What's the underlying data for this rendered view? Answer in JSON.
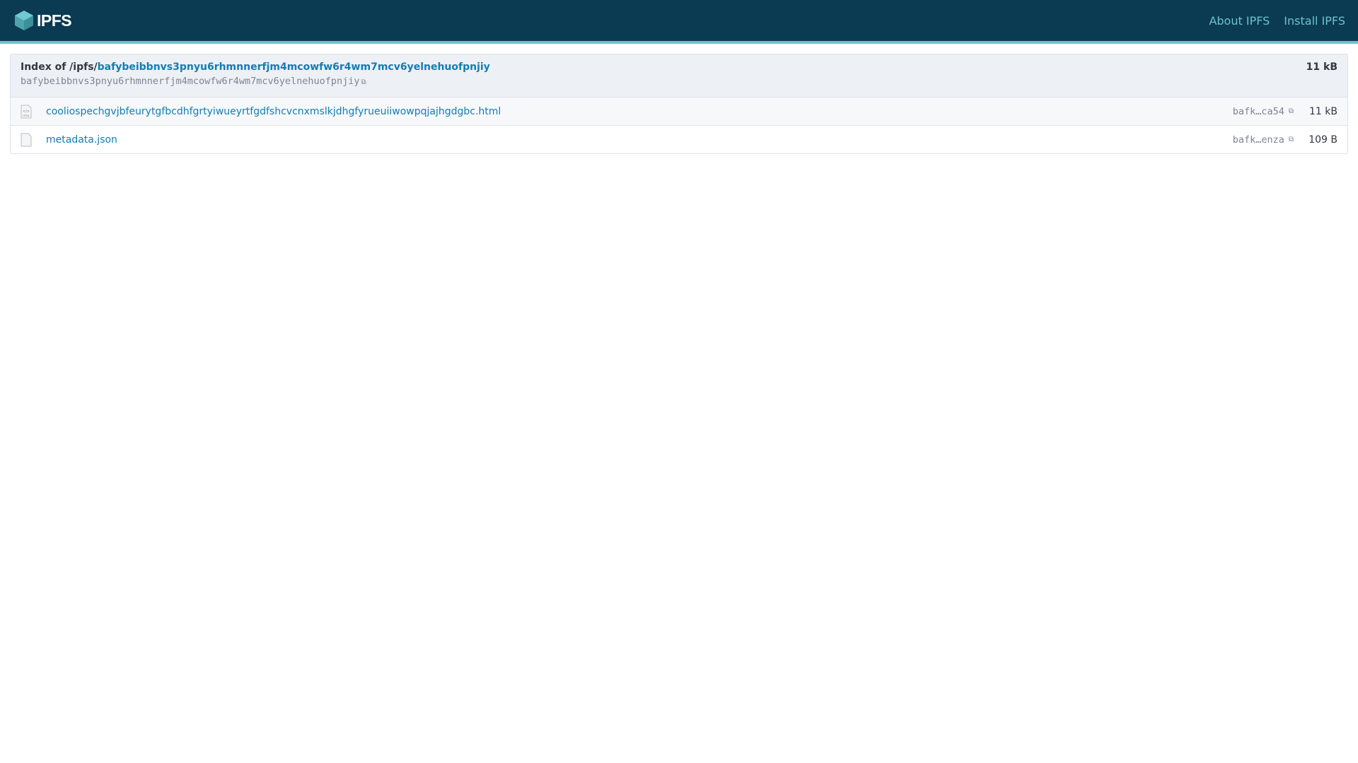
{
  "header": {
    "logo_text": "IPFS",
    "nav": [
      {
        "label": "About IPFS"
      },
      {
        "label": "Install IPFS"
      }
    ]
  },
  "index": {
    "prefix": "Index of /ipfs/",
    "cid_link": "bafybeibbnvs3pnyu6rhmnnerfjm4mcowfw6r4wm7mcv6yelnehuofpnjiy",
    "cid_sub": "bafybeibbnvs3pnyu6rhmnnerfjm4mcowfw6r4wm7mcv6yelnehuofpnjiy",
    "total_size": "11 kB"
  },
  "files": [
    {
      "name": "cooliospechgvjbfeurytgfbcdhfgrtyiwueyrtfgdfshcvcnxmslkjdhgfyrueuiiwowpqjajhgdgbc.html",
      "cid": "bafk…ca54",
      "size": "11 kB",
      "icon": "html-file-icon"
    },
    {
      "name": "metadata.json",
      "cid": "bafk…enza",
      "size": "109 B",
      "icon": "file-icon"
    }
  ]
}
